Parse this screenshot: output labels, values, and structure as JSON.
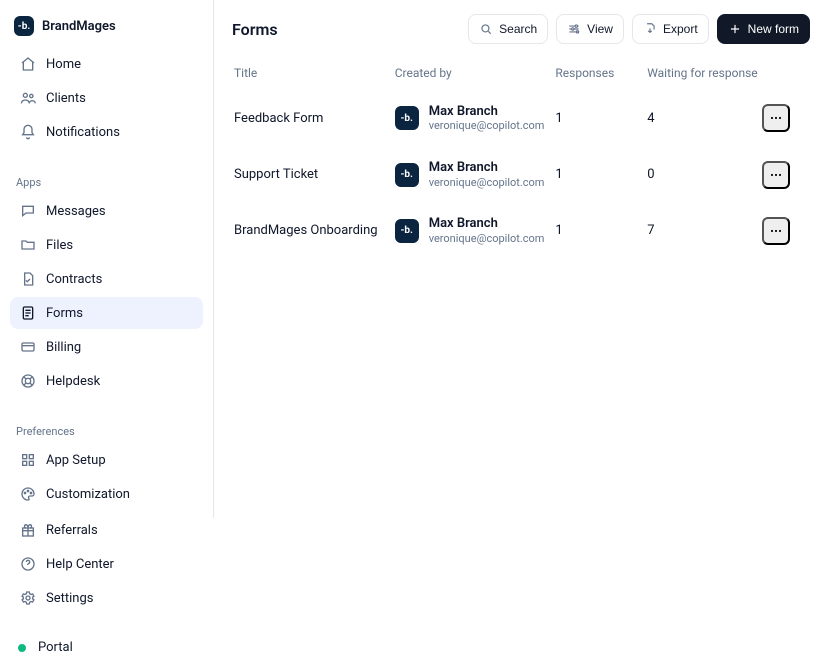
{
  "brand": {
    "name": "BrandMages",
    "logo_text": "-b."
  },
  "sidebar": {
    "primary": [
      {
        "label": "Home",
        "icon": "home-icon"
      },
      {
        "label": "Clients",
        "icon": "users-icon"
      },
      {
        "label": "Notifications",
        "icon": "bell-icon"
      }
    ],
    "apps_label": "Apps",
    "apps": [
      {
        "label": "Messages",
        "icon": "chat-icon"
      },
      {
        "label": "Files",
        "icon": "folder-icon"
      },
      {
        "label": "Contracts",
        "icon": "file-check-icon"
      },
      {
        "label": "Forms",
        "icon": "form-icon",
        "active": true
      },
      {
        "label": "Billing",
        "icon": "card-icon"
      },
      {
        "label": "Helpdesk",
        "icon": "life-ring-icon"
      }
    ],
    "preferences_label": "Preferences",
    "preferences": [
      {
        "label": "App Setup",
        "icon": "grid-icon"
      },
      {
        "label": "Customization",
        "icon": "palette-icon"
      }
    ],
    "footer": [
      {
        "label": "Referrals",
        "icon": "gift-icon"
      },
      {
        "label": "Help Center",
        "icon": "help-icon"
      },
      {
        "label": "Settings",
        "icon": "gear-icon"
      }
    ],
    "portal_label": "Portal"
  },
  "page": {
    "title": "Forms",
    "toolbar": {
      "search_label": "Search",
      "view_label": "View",
      "export_label": "Export",
      "new_label": "New form"
    },
    "columns": {
      "title": "Title",
      "created_by": "Created by",
      "responses": "Responses",
      "waiting": "Waiting for response"
    },
    "rows": [
      {
        "title": "Feedback Form",
        "creator": {
          "name": "Max Branch",
          "email": "veronique@copilot.com",
          "avatar_text": "-b."
        },
        "responses": "1",
        "waiting": "4"
      },
      {
        "title": "Support Ticket",
        "creator": {
          "name": "Max Branch",
          "email": "veronique@copilot.com",
          "avatar_text": "-b."
        },
        "responses": "1",
        "waiting": "0"
      },
      {
        "title": "BrandMages Onboarding",
        "creator": {
          "name": "Max Branch",
          "email": "veronique@copilot.com",
          "avatar_text": "-b."
        },
        "responses": "1",
        "waiting": "7"
      }
    ]
  }
}
